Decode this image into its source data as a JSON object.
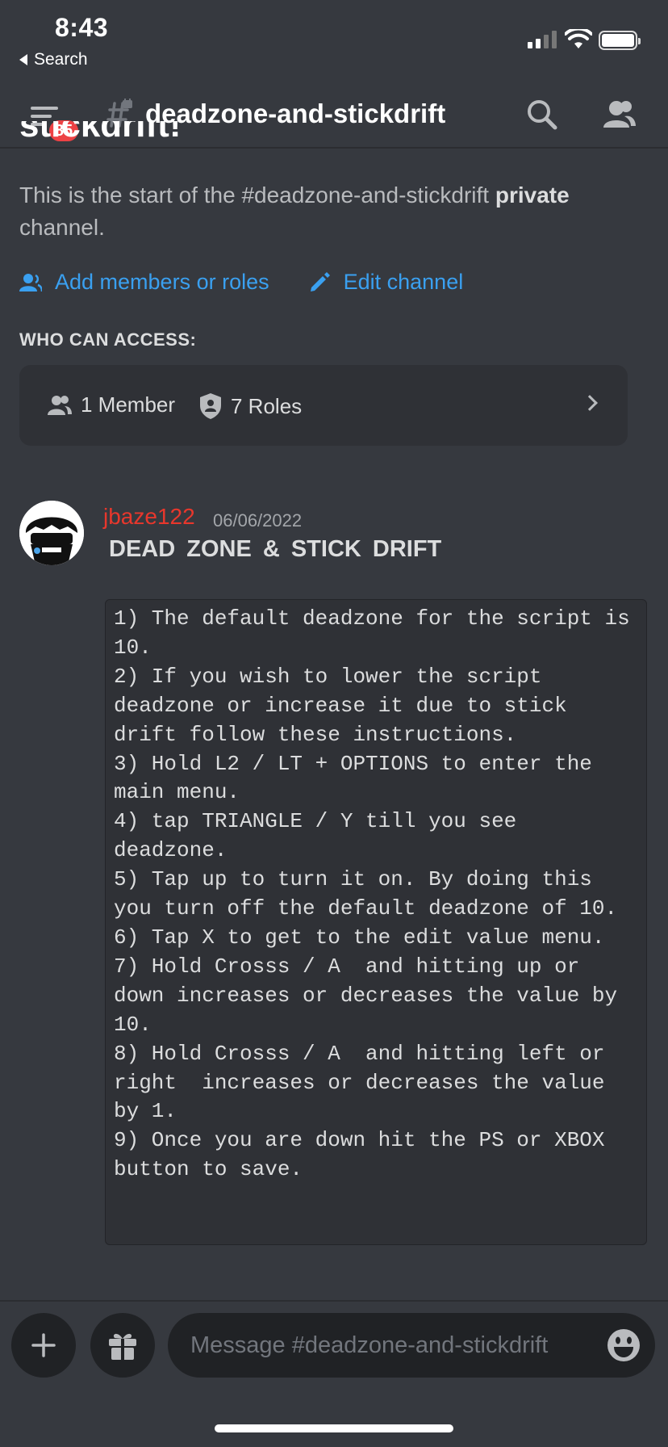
{
  "status_bar": {
    "time": "8:43",
    "back_label": "Search"
  },
  "header": {
    "unread_badge": "85",
    "channel_name": "deadzone-and-stickdrift"
  },
  "intro": {
    "title_partial": "stickdrift!",
    "text_before": "This is the start of the #deadzone-and-stickdrift ",
    "text_bold": "private",
    "text_after": " channel."
  },
  "actions": {
    "add_members": "Add members or roles",
    "edit_channel": "Edit channel"
  },
  "access": {
    "heading": "WHO CAN ACCESS:",
    "members": "1 Member",
    "roles": "7 Roles"
  },
  "message": {
    "author": "jbaze122",
    "timestamp": "06/06/2022",
    "title": "DEAD ZONE & STICK DRIFT",
    "code": "1) The default deadzone for the script is 10.\n2) If you wish to lower the script deadzone or increase it due to stick drift follow these instructions.\n3) Hold L2 / LT + OPTIONS to enter the main menu.\n4) tap TRIANGLE / Y till you see deadzone.\n5) Tap up to turn it on. By doing this you turn off the default deadzone of 10.\n6) Tap X to get to the edit value menu.\n7) Hold Crosss / A  and hitting up or down increases or decreases the value by 10.\n8) Hold Crosss / A  and hitting left or right  increases or decreases the value by 1.\n9) Once you are down hit the PS or XBOX button to save."
  },
  "composer": {
    "placeholder": "Message #deadzone-and-stickdrift"
  },
  "colors": {
    "background": "#36393f",
    "accent_link": "#3aa0f0",
    "username": "#e8372c",
    "badge": "#ed4245"
  }
}
